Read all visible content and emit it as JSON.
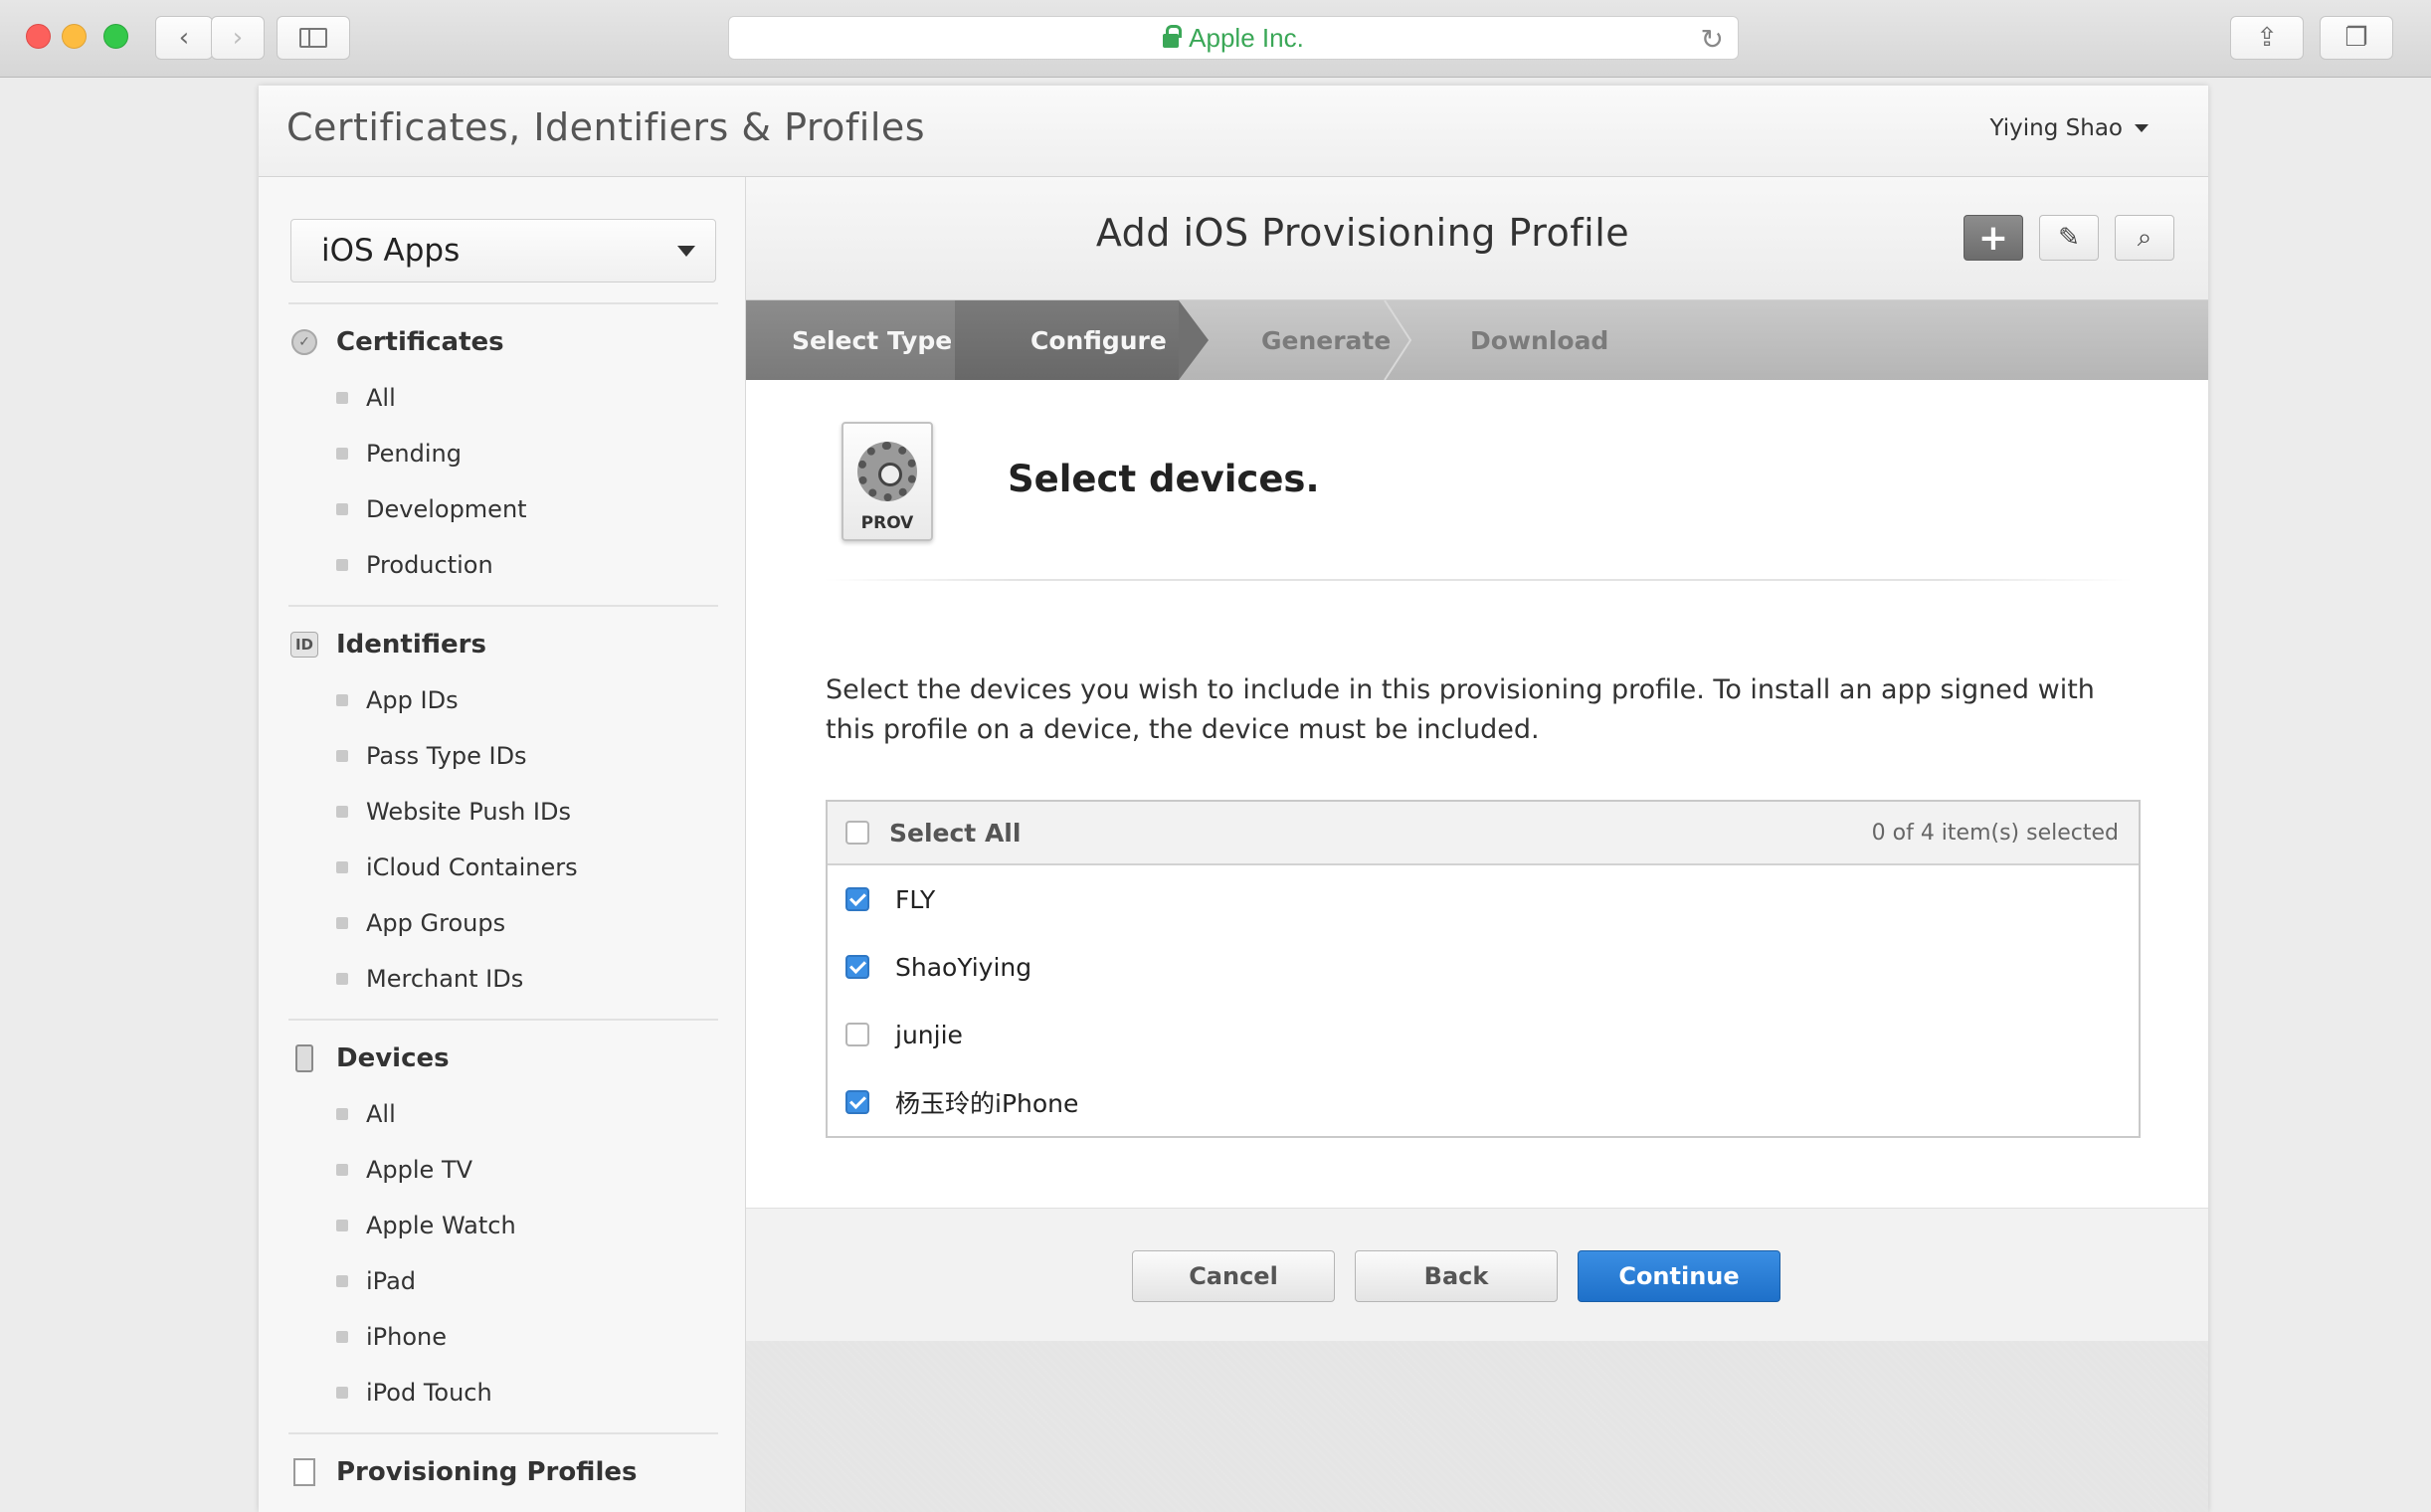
{
  "browser": {
    "address": "Apple Inc."
  },
  "page": {
    "title": "Certificates, Identifiers & Profiles",
    "user": "Yiying Shao"
  },
  "sidebar": {
    "platform": "iOS Apps",
    "sections": [
      {
        "title": "Certificates",
        "icon": "certificate-icon",
        "items": [
          "All",
          "Pending",
          "Development",
          "Production"
        ]
      },
      {
        "title": "Identifiers",
        "icon": "id-icon",
        "icon_text": "ID",
        "items": [
          "App IDs",
          "Pass Type IDs",
          "Website Push IDs",
          "iCloud Containers",
          "App Groups",
          "Merchant IDs"
        ]
      },
      {
        "title": "Devices",
        "icon": "device-icon",
        "items": [
          "All",
          "Apple TV",
          "Apple Watch",
          "iPad",
          "iPhone",
          "iPod Touch"
        ]
      },
      {
        "title": "Provisioning Profiles",
        "icon": "document-icon",
        "items": []
      }
    ]
  },
  "main": {
    "title": "Add iOS Provisioning Profile",
    "steps": [
      "Select Type",
      "Configure",
      "Generate",
      "Download"
    ],
    "prov_label": "PROV",
    "heading": "Select devices.",
    "description": "Select the devices you wish to include in this provisioning profile. To install an app signed with this profile on a device, the device must be included.",
    "table": {
      "select_all": "Select All",
      "count": "0 of 4 item(s) selected",
      "devices": [
        {
          "name": "FLY",
          "checked": true
        },
        {
          "name": "ShaoYiying",
          "checked": true
        },
        {
          "name": "junjie",
          "checked": false
        },
        {
          "name": "杨玉玲的iPhone",
          "checked": true
        }
      ]
    },
    "buttons": {
      "cancel": "Cancel",
      "back": "Back",
      "continue": "Continue"
    }
  },
  "colors": {
    "accent": "#3b8fe4",
    "secure": "#3aa757"
  }
}
